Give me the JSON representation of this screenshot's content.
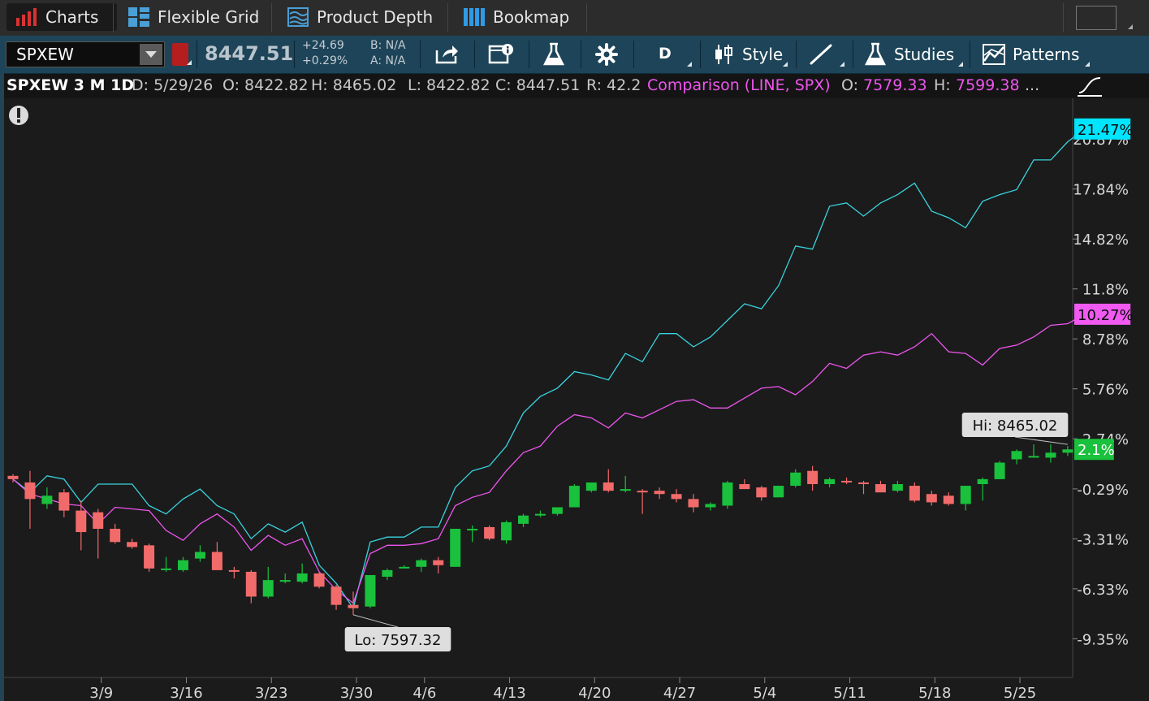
{
  "tabs": {
    "charts": "Charts",
    "flexible_grid": "Flexible Grid",
    "product_depth": "Product Depth",
    "bookmap": "Bookmap"
  },
  "toolbar": {
    "symbol": "SPXEW",
    "last_price": "8447.51",
    "net_change": "+24.69",
    "pct_change": "+0.29%",
    "bid": "B: N/A",
    "ask": "A: N/A",
    "aggregation": "D",
    "style_label": "Style",
    "studies_label": "Studies",
    "patterns_label": "Patterns"
  },
  "info": {
    "title": "SPXEW 3 M 1D",
    "date": "D: 5/29/26",
    "open": "O: 8422.82",
    "high": "H: 8465.02",
    "low": "L: 8422.82",
    "close": "C: 8447.51",
    "range": "R: 42.2",
    "comparison": "Comparison (LINE, SPX)",
    "cmp_open_label": "O:",
    "cmp_open": "7579.33",
    "cmp_high_label": "H:",
    "cmp_high": "7599.38",
    "more": "..."
  },
  "colors": {
    "up": "#19c13c",
    "down": "#f26b6b",
    "comparison": "#ee55ee",
    "cyan": "#38d3de",
    "background": "#1b1b1b"
  },
  "chart_data": {
    "type": "candlestick",
    "y_axis_unit": "percent",
    "y_ticks": [
      "20.87%",
      "17.84%",
      "14.82%",
      "11.8%",
      "8.78%",
      "5.76%",
      "2.74%",
      "-0.29%",
      "-3.31%",
      "-6.33%",
      "-9.35%"
    ],
    "y_tick_values": [
      20.87,
      17.84,
      14.82,
      11.8,
      8.78,
      5.76,
      2.74,
      -0.29,
      -3.31,
      -6.33,
      -9.35
    ],
    "x_ticks": [
      "3/9",
      "3/16",
      "3/23",
      "3/30",
      "4/6",
      "4/13",
      "4/20",
      "4/27",
      "5/4",
      "5/11",
      "5/18",
      "5/25"
    ],
    "x_tick_bar_index": [
      5,
      10,
      15,
      20,
      24,
      29,
      34,
      39,
      44,
      49,
      54,
      59
    ],
    "candles": [
      {
        "o": 0.5,
        "h": 0.6,
        "l": 0.1,
        "c": 0.3
      },
      {
        "o": 0.1,
        "h": 0.8,
        "l": -2.7,
        "c": -0.9
      },
      {
        "o": -1.2,
        "h": -0.2,
        "l": -1.5,
        "c": -0.7
      },
      {
        "o": -0.5,
        "h": -0.3,
        "l": -2.0,
        "c": -1.6
      },
      {
        "o": -1.6,
        "h": -1.0,
        "l": -4.0,
        "c": -2.9
      },
      {
        "o": -1.7,
        "h": -1.5,
        "l": -4.5,
        "c": -2.7
      },
      {
        "o": -2.7,
        "h": -2.4,
        "l": -3.6,
        "c": -3.5
      },
      {
        "o": -3.5,
        "h": -3.3,
        "l": -3.9,
        "c": -3.8
      },
      {
        "o": -3.7,
        "h": -3.6,
        "l": -5.3,
        "c": -5.1
      },
      {
        "o": -5.1,
        "h": -4.4,
        "l": -5.3,
        "c": -5.1
      },
      {
        "o": -5.2,
        "h": -4.4,
        "l": -5.3,
        "c": -4.6
      },
      {
        "o": -4.5,
        "h": -3.7,
        "l": -4.7,
        "c": -4.1
      },
      {
        "o": -4.1,
        "h": -3.5,
        "l": -5.2,
        "c": -5.2
      },
      {
        "o": -5.2,
        "h": -5.0,
        "l": -5.7,
        "c": -5.3
      },
      {
        "o": -5.3,
        "h": -5.2,
        "l": -7.2,
        "c": -6.8
      },
      {
        "o": -6.8,
        "h": -5.0,
        "l": -6.9,
        "c": -5.8
      },
      {
        "o": -5.9,
        "h": -5.4,
        "l": -6.0,
        "c": -5.8
      },
      {
        "o": -5.9,
        "h": -4.8,
        "l": -6.0,
        "c": -5.4
      },
      {
        "o": -5.4,
        "h": -5.3,
        "l": -6.3,
        "c": -6.2
      },
      {
        "o": -6.2,
        "h": -6.1,
        "l": -7.6,
        "c": -7.3
      },
      {
        "o": -7.3,
        "h": -6.5,
        "l": -7.9,
        "c": -7.5
      },
      {
        "o": -7.4,
        "h": -5.6,
        "l": -7.5,
        "c": -5.5
      },
      {
        "o": -5.6,
        "h": -5.1,
        "l": -5.8,
        "c": -5.2
      },
      {
        "o": -5.0,
        "h": -4.9,
        "l": -5.1,
        "c": -5.0
      },
      {
        "o": -5.0,
        "h": -4.5,
        "l": -5.3,
        "c": -4.6
      },
      {
        "o": -4.6,
        "h": -4.4,
        "l": -5.4,
        "c": -4.9
      },
      {
        "o": -5.0,
        "h": -2.7,
        "l": -5.0,
        "c": -2.7
      },
      {
        "o": -2.8,
        "h": -2.5,
        "l": -3.5,
        "c": -2.7
      },
      {
        "o": -2.6,
        "h": -2.5,
        "l": -3.4,
        "c": -3.3
      },
      {
        "o": -3.4,
        "h": -2.2,
        "l": -3.6,
        "c": -2.3
      },
      {
        "o": -2.4,
        "h": -1.8,
        "l": -2.6,
        "c": -1.9
      },
      {
        "o": -1.9,
        "h": -1.6,
        "l": -2.0,
        "c": -1.8
      },
      {
        "o": -1.8,
        "h": -1.4,
        "l": -1.9,
        "c": -1.4
      },
      {
        "o": -1.4,
        "h": 0.0,
        "l": -1.4,
        "c": -0.1
      },
      {
        "o": -0.4,
        "h": 0.0,
        "l": -0.5,
        "c": 0.1
      },
      {
        "o": 0.1,
        "h": 0.9,
        "l": -0.5,
        "c": -0.4
      },
      {
        "o": -0.4,
        "h": 0.5,
        "l": -0.5,
        "c": -0.3
      },
      {
        "o": -0.4,
        "h": -0.3,
        "l": -1.8,
        "c": -0.5
      },
      {
        "o": -0.4,
        "h": -0.2,
        "l": -0.9,
        "c": -0.6
      },
      {
        "o": -0.6,
        "h": -0.3,
        "l": -1.1,
        "c": -0.9
      },
      {
        "o": -0.9,
        "h": -0.6,
        "l": -1.7,
        "c": -1.4
      },
      {
        "o": -1.4,
        "h": -1.1,
        "l": -1.6,
        "c": -1.2
      },
      {
        "o": -1.3,
        "h": 0.2,
        "l": -1.5,
        "c": 0.1
      },
      {
        "o": 0.0,
        "h": 0.3,
        "l": -0.3,
        "c": -0.3
      },
      {
        "o": -0.2,
        "h": -0.1,
        "l": -1.0,
        "c": -0.8
      },
      {
        "o": -0.8,
        "h": -0.1,
        "l": -0.8,
        "c": -0.1
      },
      {
        "o": -0.1,
        "h": 0.9,
        "l": -0.2,
        "c": 0.7
      },
      {
        "o": 0.8,
        "h": 1.1,
        "l": -0.4,
        "c": 0.0
      },
      {
        "o": 0.0,
        "h": 0.4,
        "l": -0.2,
        "c": 0.3
      },
      {
        "o": 0.2,
        "h": 0.4,
        "l": 0.0,
        "c": 0.1
      },
      {
        "o": 0.1,
        "h": 0.2,
        "l": -0.6,
        "c": 0.0
      },
      {
        "o": 0.0,
        "h": 0.2,
        "l": -0.4,
        "c": -0.5
      },
      {
        "o": -0.4,
        "h": 0.2,
        "l": -0.5,
        "c": 0.0
      },
      {
        "o": -0.1,
        "h": 0.1,
        "l": -1.1,
        "c": -1.0
      },
      {
        "o": -0.6,
        "h": -0.4,
        "l": -1.3,
        "c": -1.1
      },
      {
        "o": -0.7,
        "h": -0.5,
        "l": -1.3,
        "c": -1.2
      },
      {
        "o": -1.2,
        "h": -0.1,
        "l": -1.6,
        "c": -0.1
      },
      {
        "o": 0.0,
        "h": 0.4,
        "l": -1.0,
        "c": 0.3
      },
      {
        "o": 0.3,
        "h": 1.4,
        "l": 0.3,
        "c": 1.3
      },
      {
        "o": 1.5,
        "h": 2.1,
        "l": 1.2,
        "c": 2.0
      },
      {
        "o": 1.7,
        "h": 2.4,
        "l": 1.6,
        "c": 1.7
      },
      {
        "o": 1.6,
        "h": 2.4,
        "l": 1.3,
        "c": 1.9
      },
      {
        "o": 1.9,
        "h": 2.3,
        "l": 1.7,
        "c": 2.1
      }
    ],
    "comparison_series": {
      "name": "SPX",
      "values": [
        0.3,
        -0.6,
        -0.9,
        -1.2,
        -1.3,
        -2.4,
        -1.4,
        -1.5,
        -1.6,
        -2.8,
        -3.4,
        -2.4,
        -1.8,
        -2.6,
        -4.0,
        -3.1,
        -3.7,
        -3.3,
        -5.3,
        -6.4,
        -7.2,
        -4.2,
        -3.7,
        -3.7,
        -3.6,
        -3.3,
        -1.3,
        -0.8,
        -0.5,
        0.8,
        1.9,
        2.3,
        3.5,
        4.2,
        4.0,
        3.4,
        4.3,
        4.0,
        4.5,
        5.0,
        5.1,
        4.6,
        4.6,
        5.2,
        5.8,
        5.9,
        5.4,
        6.2,
        7.3,
        7.0,
        7.8,
        8.0,
        7.8,
        8.3,
        9.1,
        8.0,
        7.9,
        7.2,
        8.2,
        8.4,
        8.9,
        9.6,
        9.7,
        10.27
      ]
    },
    "cyan_series": {
      "values": [
        0.3,
        -0.5,
        0.5,
        0.3,
        -1.1,
        0.0,
        0.0,
        0.0,
        -1.3,
        -1.8,
        -0.9,
        -0.3,
        -1.3,
        -1.8,
        -3.3,
        -2.4,
        -2.9,
        -2.3,
        -4.9,
        -6.0,
        -7.5,
        -3.5,
        -3.2,
        -3.2,
        -2.6,
        -2.6,
        -0.2,
        0.8,
        1.1,
        2.3,
        4.3,
        5.3,
        5.8,
        6.8,
        6.6,
        6.3,
        7.9,
        7.4,
        9.1,
        9.1,
        8.3,
        8.9,
        9.9,
        10.9,
        10.6,
        12.0,
        14.4,
        14.2,
        16.8,
        17.0,
        16.2,
        17.0,
        17.5,
        18.2,
        16.5,
        16.1,
        15.5,
        17.1,
        17.5,
        17.8,
        19.6,
        19.6,
        20.7,
        21.47
      ]
    },
    "labels": {
      "hi": "Hi: 8465.02",
      "lo": "Lo: 7597.32",
      "last_pct_spxew": "2.1%",
      "last_pct_spx": "10.27%",
      "last_pct_cyan": "21.47%"
    }
  }
}
